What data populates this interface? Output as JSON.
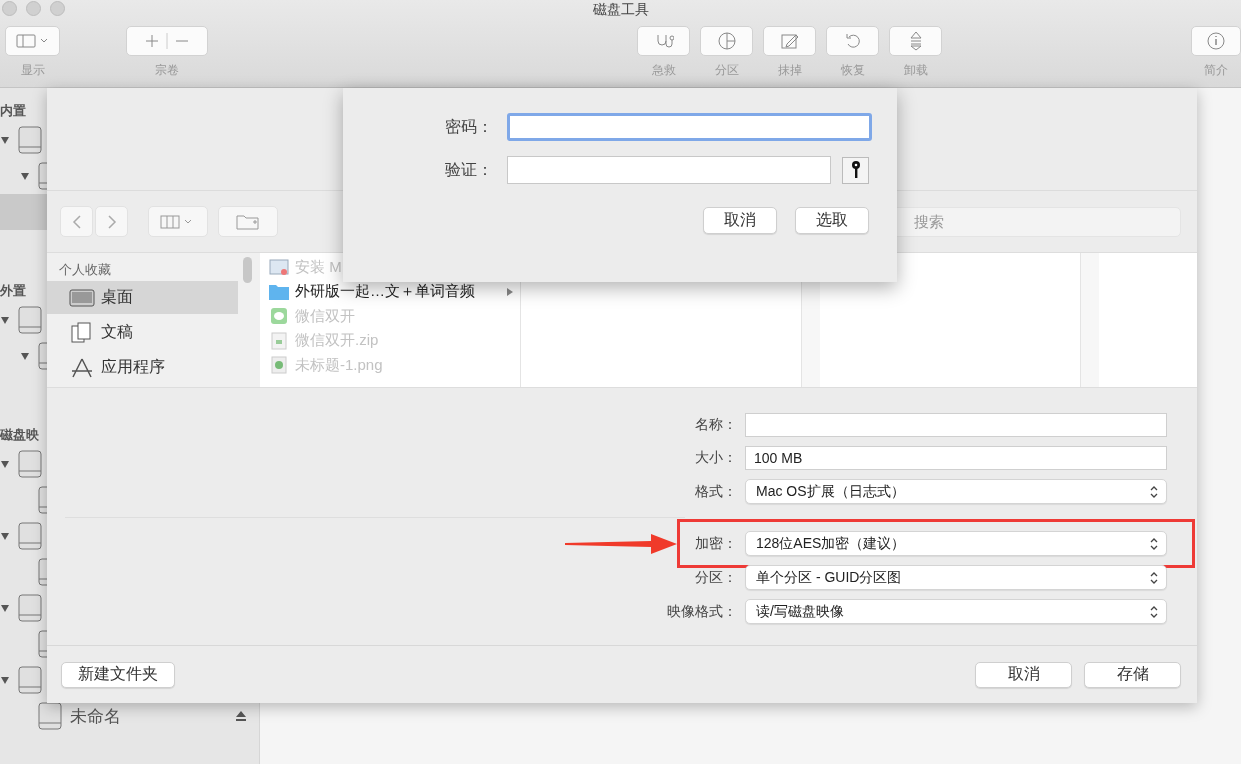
{
  "window": {
    "title": "磁盘工具"
  },
  "toolbar": {
    "left": [
      {
        "label": "显示",
        "kind": "sidebar"
      },
      {
        "label": "宗卷",
        "kind": "plusminus"
      }
    ],
    "center": [
      {
        "label": "急救",
        "kind": "firstaid"
      },
      {
        "label": "分区",
        "kind": "partition"
      },
      {
        "label": "抹掉",
        "kind": "erase"
      },
      {
        "label": "恢复",
        "kind": "restore"
      },
      {
        "label": "卸载",
        "kind": "unmount"
      }
    ],
    "right": [
      {
        "label": "简介",
        "kind": "info"
      }
    ]
  },
  "sidebar": {
    "sections": [
      {
        "title": "内置",
        "items": [
          {
            "selected": false,
            "expanded": true,
            "children": [
              {
                "selected": false,
                "expanded": true,
                "children": [
                  {
                    "selected": true
                  }
                ]
              }
            ]
          }
        ]
      },
      {
        "title": "外置",
        "items": [
          {
            "selected": false,
            "expanded": true,
            "children": [
              {
                "selected": false,
                "expanded": true
              }
            ]
          }
        ]
      },
      {
        "title": "磁盘映",
        "items": [
          {
            "selected": false,
            "expanded": true,
            "children": [
              {
                "selected": false
              }
            ]
          },
          {
            "selected": false,
            "expanded": true,
            "children": [
              {
                "selected": false
              }
            ]
          },
          {
            "selected": false,
            "expanded": true,
            "children": [
              {
                "selected": false
              }
            ]
          },
          {
            "selected": false,
            "expanded": true,
            "children": [
              {
                "selected": false,
                "label": "未命名",
                "ejectable": true
              }
            ]
          }
        ]
      }
    ]
  },
  "save_sheet": {
    "search": {
      "placeholder": "搜索"
    },
    "favorites": {
      "title": "个人收藏",
      "items": [
        {
          "label": "桌面",
          "kind": "desktop",
          "selected": true
        },
        {
          "label": "文稿",
          "kind": "documents",
          "selected": false
        },
        {
          "label": "应用程序",
          "kind": "apps",
          "selected": false
        }
      ]
    },
    "files": [
      {
        "name": "安装 M",
        "kind": "installer",
        "dimmed": true
      },
      {
        "name": "外研版一起…文＋单词音频",
        "kind": "folder",
        "dimmed": false
      },
      {
        "name": "微信双开",
        "kind": "app",
        "dimmed": true
      },
      {
        "name": "微信双开.zip",
        "kind": "archive",
        "dimmed": true
      },
      {
        "name": "未标题-1.png",
        "kind": "image",
        "dimmed": true
      }
    ],
    "form": [
      {
        "label": "名称：",
        "kind": "text",
        "highlighted": false
      },
      {
        "label": "大小：",
        "kind": "text",
        "value": "100 MB",
        "highlighted": false
      },
      {
        "label": "格式：",
        "kind": "popup",
        "value": "Mac OS扩展（日志式）",
        "highlighted": false
      },
      {
        "label": "加密：",
        "kind": "popup",
        "value": "128位AES加密（建议）",
        "highlighted": true
      },
      {
        "label": "分区：",
        "kind": "popup",
        "value": "单个分区 - GUID分区图",
        "highlighted": false
      },
      {
        "label": "映像格式：",
        "kind": "popup",
        "value": "读/写磁盘映像",
        "highlighted": false
      }
    ],
    "new_folder_button": "新建文件夹",
    "buttons": [
      "取消",
      "存储"
    ]
  },
  "password_sheet": {
    "fields": [
      {
        "label": "密码：",
        "focused": true,
        "key_button": false
      },
      {
        "label": "验证：",
        "focused": false,
        "key_button": true
      }
    ],
    "buttons": [
      "取消",
      "选取"
    ]
  }
}
